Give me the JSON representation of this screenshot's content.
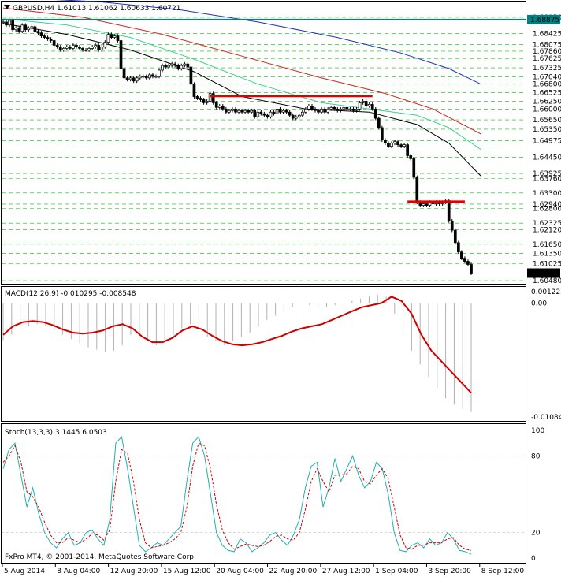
{
  "header": {
    "symbol_line": "GBPUSD,H4  1.61013 1.61062 1.60633 1.60721",
    "icon": "triangle-down-icon"
  },
  "colors": {
    "background": "#ffffff",
    "frame": "#000000",
    "grid_green": "#00c000",
    "label_green": "#00c000",
    "candle": "#000000",
    "ma_black": "#000000",
    "ma_green": "#3cd090",
    "ma_red": "#d02020",
    "ma_blue": "#2030c0",
    "hline_teal": "#008080",
    "level_red": "#e00000",
    "macd_hist": "#b0b0b0",
    "macd_signal": "#d00000",
    "stoch_main": "#20b0b0",
    "stoch_signal": "#d00000"
  },
  "price_axis": {
    "labels": [
      "1.68950",
      "1.68425",
      "1.68075",
      "1.67860",
      "1.67625",
      "1.67325",
      "1.67040",
      "1.66800",
      "1.66525",
      "1.66250",
      "1.66000",
      "1.65650",
      "1.65350",
      "1.64975",
      "1.64450",
      "1.63925",
      "1.63760",
      "1.63300",
      "1.62940",
      "1.62800",
      "1.62325",
      "1.62120",
      "1.61650",
      "1.61350",
      "1.61025",
      "1.60480"
    ],
    "boxed": [
      {
        "value": "1.68875",
        "style": "teal"
      },
      {
        "value": "1.60721",
        "style": "black"
      }
    ]
  },
  "macd_panel": {
    "title": "MACD(12,26,9) -0.010295 -0.008548",
    "axis_labels": [
      "0.001222",
      "0.00",
      "-0.010843"
    ]
  },
  "stoch_panel": {
    "title": "Stoch(13,3,3) 3.1445 6.0503",
    "axis_labels": [
      "100",
      "80",
      "20",
      "0"
    ],
    "copyright": "FxPro MT4, © 2001-2014, MetaQuotes Software Corp."
  },
  "time_axis": {
    "labels": [
      "5 Aug 2014",
      "8 Aug 04:00",
      "12 Aug 20:00",
      "15 Aug 12:00",
      "20 Aug 04:00",
      "22 Aug 20:00",
      "27 Aug 12:00",
      "1 Sep 04:00",
      "3 Sep 20:00",
      "8 Sep 12:00"
    ]
  },
  "chart_data": {
    "type": "candlestick",
    "title": "GBPUSD,H4",
    "symbol": "GBPUSD",
    "timeframe": "H4",
    "last_bar": {
      "open": 1.61013,
      "high": 1.61062,
      "low": 1.60633,
      "close": 1.60721
    },
    "price_range": [
      1.6048,
      1.6905
    ],
    "hlines": [
      {
        "price": 1.68875,
        "color": "teal"
      }
    ],
    "levels": [
      {
        "price": 1.6642,
        "from_bar": 65,
        "to_bar": 116
      },
      {
        "price": 1.6302,
        "from_bar": 127,
        "to_bar": 145
      }
    ],
    "closes": [
      1.688,
      1.687,
      1.6885,
      1.6855,
      1.686,
      1.685,
      1.687,
      1.6855,
      1.686,
      1.6865,
      1.685,
      1.6845,
      1.6835,
      1.683,
      1.6825,
      1.682,
      1.6805,
      1.68,
      1.679,
      1.6795,
      1.68,
      1.6795,
      1.6805,
      1.68,
      1.6795,
      1.679,
      1.679,
      1.6795,
      1.68,
      1.6805,
      1.679,
      1.68,
      1.6815,
      1.684,
      1.683,
      1.6835,
      1.682,
      1.673,
      1.67,
      1.6695,
      1.67,
      1.669,
      1.67,
      1.6705,
      1.6705,
      1.67,
      1.671,
      1.6705,
      1.6705,
      1.6725,
      1.674,
      1.6735,
      1.674,
      1.6745,
      1.674,
      1.673,
      1.674,
      1.6745,
      1.6735,
      1.668,
      1.664,
      1.6635,
      1.663,
      1.662,
      1.6625,
      1.665,
      1.662,
      1.6605,
      1.661,
      1.66,
      1.659,
      1.6595,
      1.66,
      1.659,
      1.6595,
      1.659,
      1.6595,
      1.659,
      1.6595,
      1.6575,
      1.659,
      1.6585,
      1.658,
      1.6575,
      1.659,
      1.6585,
      1.66,
      1.659,
      1.6595,
      1.659,
      1.658,
      1.657,
      1.6575,
      1.658,
      1.659,
      1.66,
      1.661,
      1.66,
      1.6595,
      1.659,
      1.66,
      1.659,
      1.66,
      1.6605,
      1.66,
      1.6595,
      1.66,
      1.6605,
      1.66,
      1.66,
      1.6595,
      1.66,
      1.662,
      1.6625,
      1.661,
      1.6615,
      1.66,
      1.657,
      1.654,
      1.65,
      1.649,
      1.648,
      1.649,
      1.6495,
      1.6485,
      1.648,
      1.6485,
      1.645,
      1.644,
      1.638,
      1.63,
      1.629,
      1.6295,
      1.629,
      1.63,
      1.6295,
      1.63,
      1.6295,
      1.63,
      1.6305,
      1.624,
      1.621,
      1.617,
      1.614,
      1.612,
      1.611,
      1.61,
      1.6072
    ],
    "moving_averages": [
      {
        "color": "black",
        "points": [
          [
            0,
            1.6875
          ],
          [
            20,
            1.684
          ],
          [
            40,
            1.679
          ],
          [
            60,
            1.672
          ],
          [
            75,
            1.664
          ],
          [
            95,
            1.66
          ],
          [
            115,
            1.659
          ],
          [
            130,
            1.655
          ],
          [
            140,
            1.649
          ],
          [
            150,
            1.6385
          ]
        ]
      },
      {
        "color": "green",
        "points": [
          [
            0,
            1.689
          ],
          [
            20,
            1.687
          ],
          [
            40,
            1.683
          ],
          [
            60,
            1.676
          ],
          [
            80,
            1.668
          ],
          [
            100,
            1.662
          ],
          [
            115,
            1.66
          ],
          [
            130,
            1.658
          ],
          [
            140,
            1.654
          ],
          [
            150,
            1.647
          ]
        ]
      },
      {
        "color": "red",
        "points": [
          [
            0,
            1.6925
          ],
          [
            25,
            1.6895
          ],
          [
            50,
            1.684
          ],
          [
            75,
            1.677
          ],
          [
            100,
            1.67
          ],
          [
            120,
            1.665
          ],
          [
            135,
            1.66
          ],
          [
            150,
            1.652
          ]
        ]
      },
      {
        "color": "blue",
        "points": [
          [
            0,
            1.696
          ],
          [
            30,
            1.6945
          ],
          [
            55,
            1.692
          ],
          [
            80,
            1.688
          ],
          [
            105,
            1.683
          ],
          [
            125,
            1.678
          ],
          [
            140,
            1.673
          ],
          [
            150,
            1.668
          ]
        ]
      }
    ],
    "macd": {
      "range": [
        -0.010843,
        0.001222
      ],
      "histogram": [
        -0.0035,
        -0.003,
        -0.0025,
        -0.0022,
        -0.002,
        -0.0022,
        -0.0026,
        -0.003,
        -0.0034,
        -0.0038,
        -0.0042,
        -0.0044,
        -0.0046,
        -0.0045,
        -0.004,
        -0.003,
        -0.0028,
        -0.0036,
        -0.004,
        -0.0038,
        -0.003,
        -0.0024,
        -0.002,
        -0.0025,
        -0.0032,
        -0.0036,
        -0.004,
        -0.0036,
        -0.0032,
        -0.0028,
        -0.0022,
        -0.0016,
        -0.0012,
        -0.0008,
        -0.0004,
        0.0,
        -0.0002,
        -0.0005,
        -0.0004,
        -0.0002,
        0.0,
        0.0002,
        0.0004,
        0.0006,
        0.0008,
        0.0006,
        -0.001,
        -0.003,
        -0.0045,
        -0.0058,
        -0.007,
        -0.008,
        -0.009,
        -0.0096,
        -0.01,
        -0.0103
      ],
      "signal": [
        -0.003,
        -0.0022,
        -0.0018,
        -0.0017,
        -0.0018,
        -0.0021,
        -0.0025,
        -0.0028,
        -0.0029,
        -0.0028,
        -0.0026,
        -0.0022,
        -0.002,
        -0.0024,
        -0.0032,
        -0.0037,
        -0.0037,
        -0.0033,
        -0.0026,
        -0.0022,
        -0.0025,
        -0.0031,
        -0.0036,
        -0.0039,
        -0.004,
        -0.0039,
        -0.0037,
        -0.0034,
        -0.0031,
        -0.0027,
        -0.0024,
        -0.0022,
        -0.002,
        -0.0016,
        -0.0012,
        -0.0008,
        -0.0004,
        -0.0002,
        0.0,
        0.0006,
        0.0002,
        -0.001,
        -0.003,
        -0.0045,
        -0.0055,
        -0.0065,
        -0.0075,
        -0.0085
      ]
    },
    "stochastic": {
      "range": [
        0,
        100
      ],
      "levels": [
        20,
        80
      ],
      "main": [
        70,
        85,
        90,
        65,
        40,
        55,
        35,
        20,
        12,
        8,
        15,
        20,
        10,
        12,
        20,
        22,
        15,
        10,
        30,
        90,
        95,
        70,
        40,
        10,
        5,
        8,
        12,
        10,
        15,
        20,
        25,
        60,
        90,
        95,
        80,
        50,
        20,
        10,
        6,
        5,
        15,
        12,
        5,
        8,
        12,
        18,
        20,
        14,
        10,
        18,
        30,
        55,
        72,
        75,
        40,
        55,
        78,
        60,
        70,
        80,
        65,
        55,
        60,
        75,
        70,
        50,
        20,
        6,
        5,
        10,
        12,
        8,
        15,
        10,
        12,
        20,
        15,
        6,
        5,
        3
      ],
      "signal": [
        75,
        80,
        88,
        75,
        52,
        48,
        40,
        28,
        18,
        12,
        12,
        16,
        14,
        12,
        15,
        19,
        18,
        14,
        22,
        60,
        85,
        82,
        60,
        30,
        12,
        8,
        9,
        10,
        12,
        15,
        20,
        40,
        72,
        90,
        88,
        70,
        42,
        22,
        12,
        7,
        9,
        11,
        10,
        9,
        10,
        13,
        17,
        18,
        15,
        14,
        20,
        38,
        60,
        70,
        60,
        52,
        65,
        65,
        66,
        72,
        70,
        60,
        58,
        65,
        70,
        62,
        40,
        18,
        8,
        7,
        10,
        10,
        12,
        12,
        12,
        15,
        16,
        10,
        7,
        6
      ]
    }
  }
}
